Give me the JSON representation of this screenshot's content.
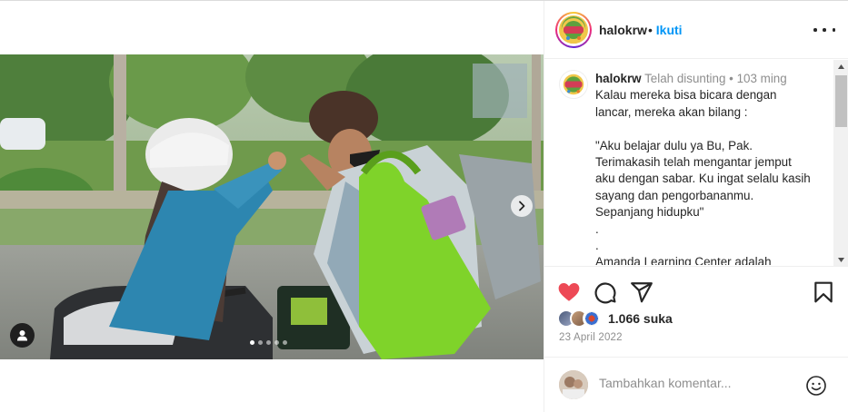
{
  "post": {
    "username": "halokrw",
    "follow_sep": "•",
    "follow_label": "Ikuti",
    "avatar_text": "Halokrw"
  },
  "caption": {
    "username": "halokrw",
    "edited": "Telah disunting",
    "dot": "•",
    "age": "103 ming",
    "lines": [
      "Kalau mereka bisa bicara dengan",
      "lancar, mereka akan bilang :",
      "",
      "\"Aku belajar dulu ya Bu, Pak.",
      "Terimakasih telah mengantar jemput",
      "aku dengan sabar. Ku ingat selalu kasih",
      "sayang dan pengorbananmu.",
      "Sepanjang hidupku\"",
      ".",
      ".",
      "Amanda Learning Center adalah"
    ]
  },
  "actions": {
    "like_icon": "heart-filled-icon",
    "comment_icon": "comment-bubble-icon",
    "share_icon": "paper-plane-icon",
    "save_icon": "bookmark-icon",
    "like_color": "#ed4956"
  },
  "likes": {
    "count_label": "1.066 suka"
  },
  "date": "23 April 2022",
  "comment_box": {
    "placeholder": "Tambahkan komentar...",
    "emoji_icon": "smiley-icon"
  },
  "carousel": {
    "total": 5,
    "active": 1
  }
}
